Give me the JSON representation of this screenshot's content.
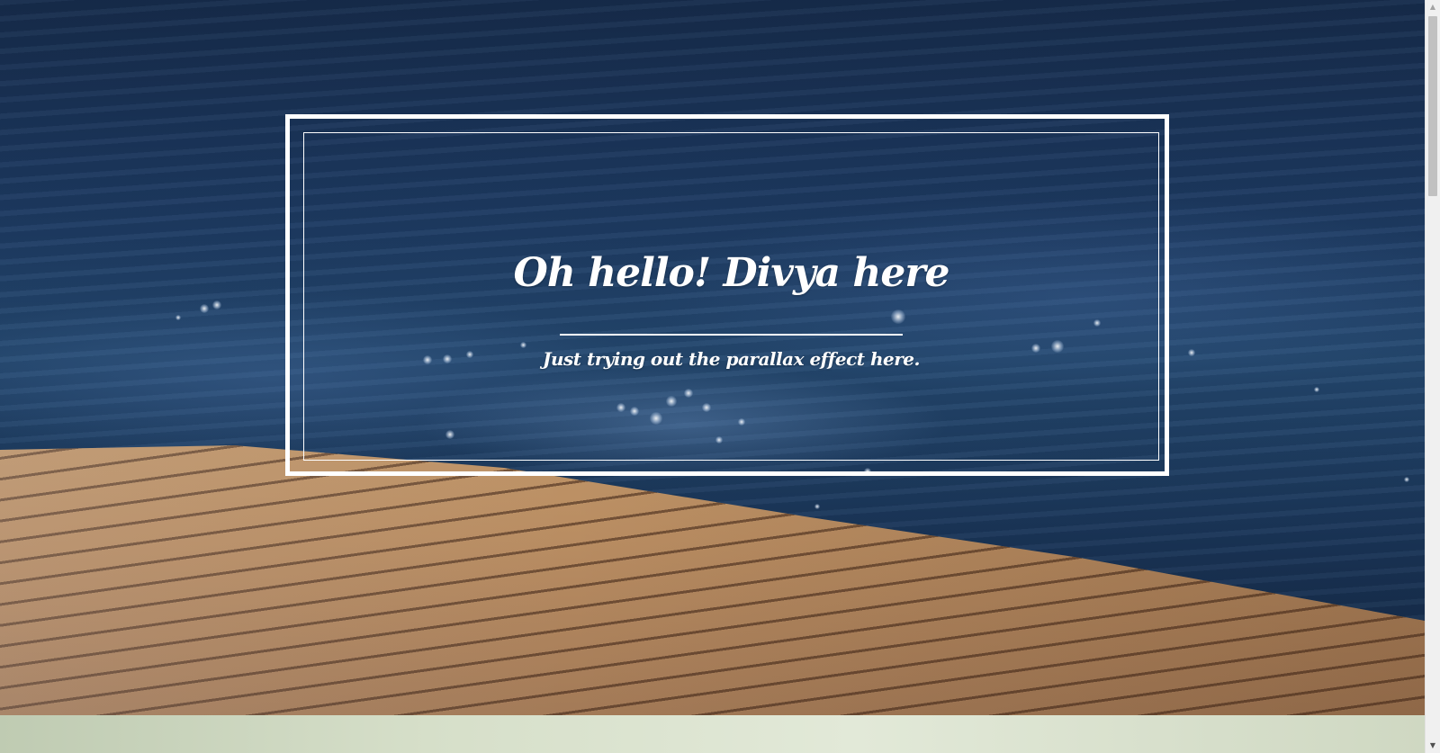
{
  "hero": {
    "title": "Oh hello! Divya here",
    "subtitle": "Just trying out the parallax effect here."
  },
  "scrollbar": {
    "up_arrow": "▲",
    "down_arrow": "▼"
  },
  "colors": {
    "frame": "#ffffff",
    "water": "#1d3a62",
    "dock": "#c59b6c",
    "next_section": "#d6dfc9"
  }
}
